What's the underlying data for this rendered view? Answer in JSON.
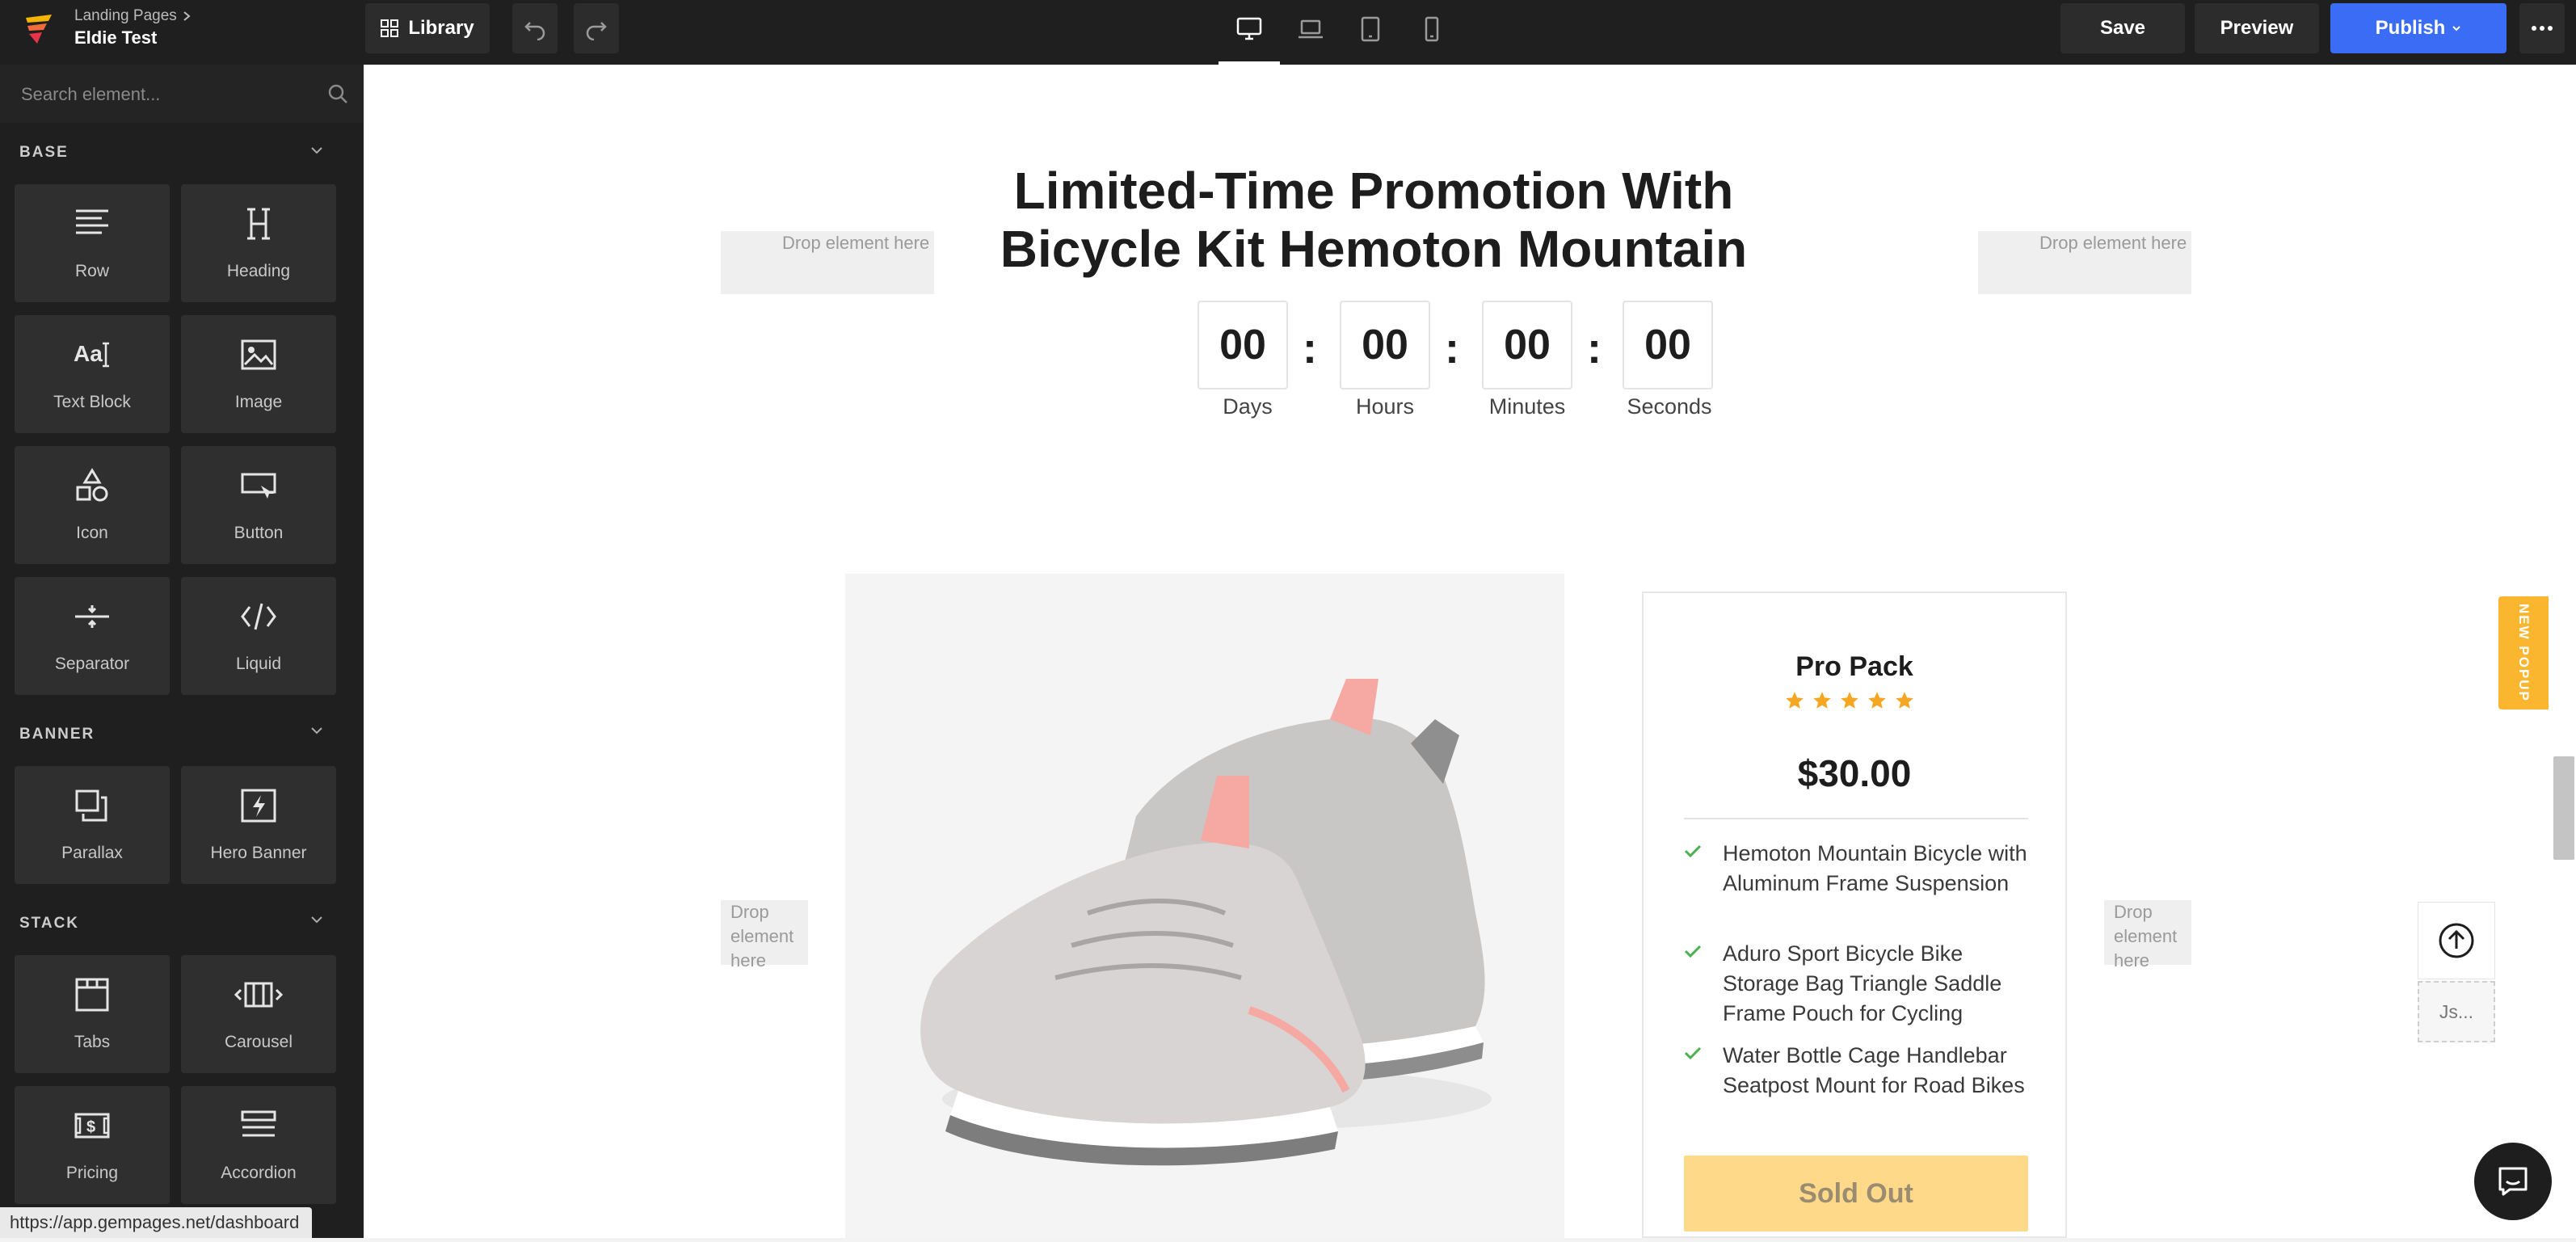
{
  "header": {
    "breadcrumb": "Landing Pages",
    "page_name": "Eldie Test",
    "library_label": "Library",
    "save_label": "Save",
    "preview_label": "Preview",
    "publish_label": "Publish",
    "devices": [
      "desktop-icon",
      "laptop-icon",
      "tablet-icon",
      "mobile-icon"
    ],
    "active_device": "desktop"
  },
  "sidebar": {
    "search_placeholder": "Search element...",
    "sections": [
      {
        "title": "BASE",
        "items": [
          "Row",
          "Heading",
          "Text Block",
          "Image",
          "Icon",
          "Button",
          "Separator",
          "Liquid"
        ]
      },
      {
        "title": "BANNER",
        "items": [
          "Parallax",
          "Hero Banner"
        ]
      },
      {
        "title": "STACK",
        "items": [
          "Tabs",
          "Carousel",
          "Pricing",
          "Accordion"
        ]
      }
    ]
  },
  "canvas": {
    "drop_text": "Drop element here",
    "headline": "Limited-Time Promotion With Bicycle Kit Hemoton Mountain",
    "countdown": [
      {
        "value": "00",
        "label": "Days"
      },
      {
        "value": "00",
        "label": "Hours"
      },
      {
        "value": "00",
        "label": "Minutes"
      },
      {
        "value": "00",
        "label": "Seconds"
      }
    ],
    "separator": ":",
    "product": {
      "title": "Pro Pack",
      "rating": 5,
      "price": "$30.00",
      "features": [
        "Hemoton Mountain Bicycle with Aluminum Frame Suspension",
        "Aduro Sport Bicycle Bike Storage Bag Triangle Saddle Frame Pouch for Cycling",
        "Water Bottle Cage Handlebar Seatpost Mount for Road Bikes"
      ],
      "button_label": "Sold Out"
    },
    "new_popup_label": "NEW POPUP",
    "js_label": "Js..."
  },
  "status_url": "https://app.gempages.net/dashboard",
  "colors": {
    "topbar": "#1f1f1f",
    "publish": "#3b6cf6",
    "star": "#f5a623",
    "check": "#4caf50",
    "sold_out_bg": "#ffd98a",
    "new_popup": "#fbb62f"
  }
}
